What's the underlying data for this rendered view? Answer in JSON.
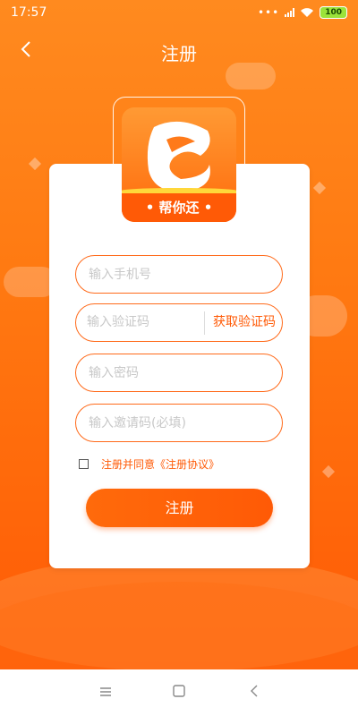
{
  "status_bar": {
    "time": "17:57",
    "signal_dots": "•••",
    "battery": "100"
  },
  "header": {
    "back_icon": "chevron-left-icon",
    "title": "注册"
  },
  "logo": {
    "ribbon_text": "• 帮你还 •"
  },
  "form": {
    "phone_placeholder": "输入手机号",
    "code_placeholder": "输入验证码",
    "get_code_label": "获取验证码",
    "password_placeholder": "输入密码",
    "invite_placeholder": "输入邀请码(必填)",
    "agree_text": "注册并同意《注册协议》",
    "submit_label": "注册"
  },
  "nav_bar": {
    "menu_icon": "menu-icon",
    "home_icon": "home-square-icon",
    "back_icon": "back-triangle-icon"
  },
  "colors": {
    "accent": "#ff5a06",
    "background_top": "#ff8a1f",
    "background_bottom": "#ff5a06"
  }
}
